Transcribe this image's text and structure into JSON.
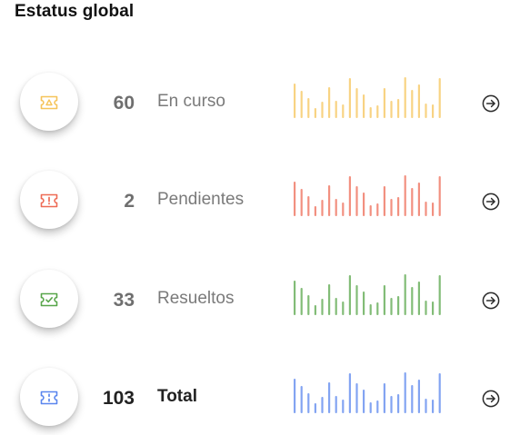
{
  "title": "Estatus global",
  "rows": [
    {
      "key": "en-curso",
      "count": "60",
      "label": "En curso",
      "color": "#f6c45a",
      "glyph": "triangle",
      "bars": [
        38,
        30,
        22,
        11,
        18,
        34,
        19,
        15,
        44,
        33,
        26,
        12,
        14,
        33,
        19,
        21,
        45,
        31,
        37,
        16,
        15,
        44
      ]
    },
    {
      "key": "pendientes",
      "count": "2",
      "label": "Pendientes",
      "color": "#ee6b55",
      "glyph": "exclaim",
      "bars": [
        38,
        30,
        22,
        11,
        18,
        34,
        19,
        15,
        44,
        33,
        26,
        12,
        14,
        33,
        19,
        21,
        45,
        31,
        37,
        16,
        15,
        44
      ]
    },
    {
      "key": "resueltos",
      "count": "33",
      "label": "Resueltos",
      "color": "#58a64a",
      "glyph": "check",
      "bars": [
        38,
        30,
        22,
        11,
        18,
        34,
        19,
        15,
        44,
        33,
        26,
        12,
        14,
        33,
        19,
        21,
        45,
        31,
        37,
        16,
        15,
        44
      ]
    },
    {
      "key": "total",
      "count": "103",
      "label": "Total",
      "color": "#5a86ee",
      "glyph": "colon",
      "bars": [
        38,
        30,
        22,
        11,
        18,
        34,
        19,
        15,
        44,
        33,
        26,
        12,
        14,
        33,
        19,
        21,
        45,
        31,
        37,
        16,
        15,
        44
      ]
    }
  ],
  "arrow_icon": "arrow-right-circle-icon",
  "ticket_icon": "ticket-icon"
}
